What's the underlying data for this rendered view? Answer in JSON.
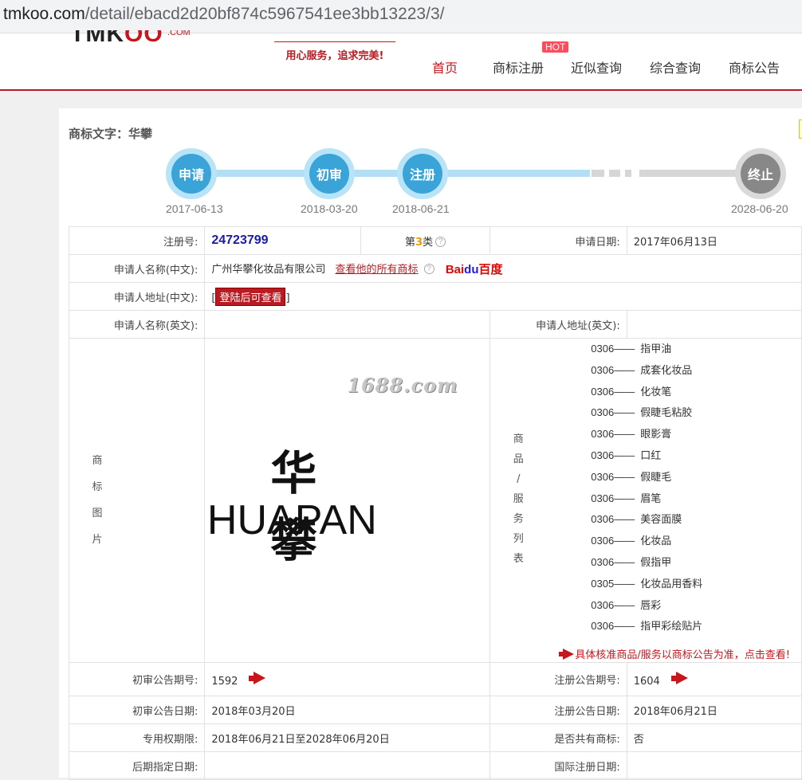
{
  "browser": {
    "url_host": "tmkoo.com",
    "url_path": "/detail/ebacd2d20bf874c5967541ee3bb13223/3/"
  },
  "header": {
    "logo_black": "TMK",
    "logo_red": "OO",
    "logo_com": ".COM",
    "slogan": "用心服务，追求完美!",
    "hot_badge": "HOT",
    "nav": [
      "首页",
      "商标注册",
      "近似查询",
      "综合查询",
      "商标公告"
    ]
  },
  "trademark": {
    "title": "商标文字：华攀",
    "timeline": [
      {
        "label": "申请",
        "date": "2017-06-13",
        "state": "done"
      },
      {
        "label": "初审",
        "date": "2018-03-20",
        "state": "done"
      },
      {
        "label": "注册",
        "date": "2018-06-21",
        "state": "done"
      },
      {
        "label": "终止",
        "date": "2028-06-20",
        "state": "future"
      }
    ],
    "reg_no_label": "注册号:",
    "reg_no": "24723799",
    "class_prefix": "第",
    "class_num": "3",
    "class_suffix": "类",
    "apply_date_label": "申请日期:",
    "apply_date": "2017年06月13日",
    "applicant_cn_label": "申请人名称(中文):",
    "applicant_cn": "广州华攀化妆品有限公司",
    "view_all_link": "查看他的所有商标",
    "baidu_red": "Bai",
    "baidu_blue": "du",
    "baidu_cn": "百度",
    "address_cn_label": "申请人地址(中文):",
    "login_to_view": "登陆后可查看",
    "applicant_en_label": "申请人名称(英文):",
    "applicant_en": "",
    "address_en_label": "申请人地址(英文):",
    "address_en": "",
    "image_label": [
      "商",
      "标",
      "图",
      "片"
    ],
    "watermark": "1688.com",
    "mark_cn": "华攀",
    "mark_en": "HUAPAN",
    "goods_label": [
      "商",
      "品",
      "/",
      "服",
      "务",
      "列",
      "表"
    ],
    "goods": [
      {
        "code": "0306——",
        "name": "指甲油"
      },
      {
        "code": "0306——",
        "name": "成套化妆品"
      },
      {
        "code": "0306——",
        "name": "化妆笔"
      },
      {
        "code": "0306——",
        "name": "假睫毛粘胶"
      },
      {
        "code": "0306——",
        "name": "眼影膏"
      },
      {
        "code": "0306——",
        "name": "口红"
      },
      {
        "code": "0306——",
        "name": "假睫毛"
      },
      {
        "code": "0306——",
        "name": "眉笔"
      },
      {
        "code": "0306——",
        "name": "美容面膜"
      },
      {
        "code": "0306——",
        "name": "化妆品"
      },
      {
        "code": "0306——",
        "name": "假指甲"
      },
      {
        "code": "0305——",
        "name": "化妆品用香料"
      },
      {
        "code": "0306——",
        "name": "唇彩"
      },
      {
        "code": "0306——",
        "name": "指甲彩绘贴片"
      }
    ],
    "goods_notice": "具体核准商品/服务以商标公告为准，点击查看!",
    "prelim_no_label": "初审公告期号:",
    "prelim_no": "1592",
    "reg_pub_no_label": "注册公告期号:",
    "reg_pub_no": "1604",
    "prelim_date_label": "初审公告日期:",
    "prelim_date": "2018年03月20日",
    "reg_pub_date_label": "注册公告日期:",
    "reg_pub_date": "2018年06月21日",
    "exclusive_label": "专用权期限:",
    "exclusive": "2018年06月21日至2028年06月20日",
    "shared_label": "是否共有商标:",
    "shared": "否",
    "later_date_label": "后期指定日期:",
    "intl_reg_label": "国际注册日期:"
  },
  "colors": {
    "accent_red": "#c8161d",
    "timeline_blue": "#3aa4d9",
    "reg_no_blue": "#1a1aa8"
  }
}
